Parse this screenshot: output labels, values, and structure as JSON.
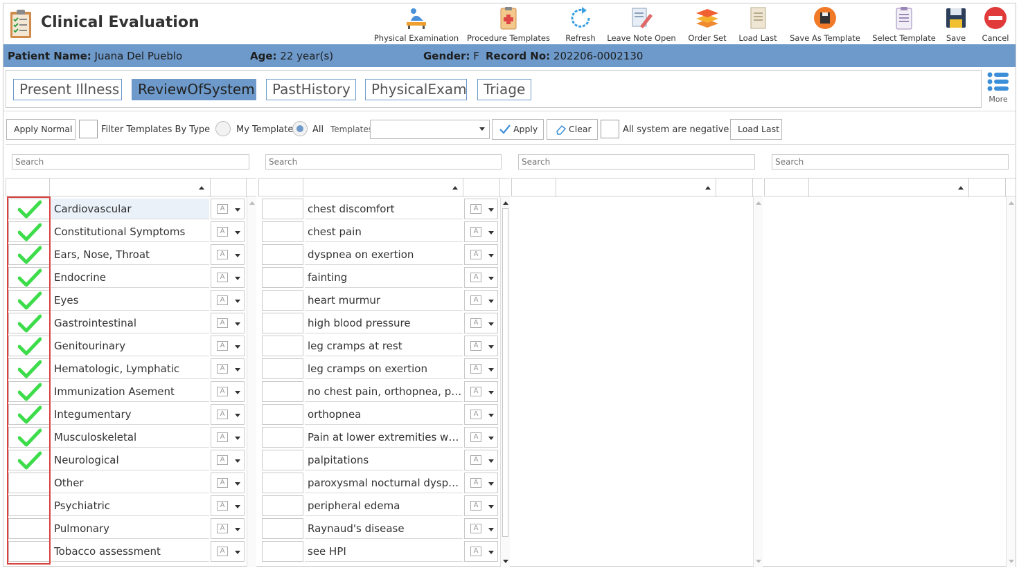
{
  "app": {
    "title": "Clinical Evaluation"
  },
  "toolbar": [
    {
      "label": "Physical Examination",
      "icon": "physical-exam-icon"
    },
    {
      "label": "Procedure Templates",
      "icon": "clipboard-icon"
    },
    {
      "label": "Refresh",
      "icon": "refresh-icon"
    },
    {
      "label": "Leave Note Open",
      "icon": "note-pen-icon"
    },
    {
      "label": "Order Set",
      "icon": "layers-icon"
    },
    {
      "label": "Load Last",
      "icon": "document-icon"
    },
    {
      "label": "Save As Template",
      "icon": "save-circle-icon"
    },
    {
      "label": "Select Template",
      "icon": "template-list-icon"
    },
    {
      "label": "Save",
      "icon": "floppy-icon"
    },
    {
      "label": "Cancel",
      "icon": "cancel-icon"
    }
  ],
  "patient": {
    "name_label": "Patient Name:",
    "name": "Juana Del Pueblo",
    "age_label": "Age:",
    "age": "22 year(s)",
    "gender_label": "Gender:",
    "gender": "F",
    "record_label": "Record No:",
    "record": "202206-0002130"
  },
  "tabs": [
    {
      "label": "Present Illness",
      "active": false
    },
    {
      "label": "ReviewOfSystem",
      "active": true
    },
    {
      "label": "PastHistory",
      "active": false
    },
    {
      "label": "PhysicalExam",
      "active": false
    },
    {
      "label": "Triage",
      "active": false
    }
  ],
  "more_label": "More",
  "filters": {
    "apply_normal": "Apply Normal",
    "filter_by_type": "Filter Templates By Type",
    "my_templates": "My Templates",
    "all": "All",
    "templates_label": "Templates:",
    "templates_value": "",
    "apply": "Apply",
    "clear": "Clear",
    "all_negative": "All system are negative",
    "load_last": "Load Last"
  },
  "search_placeholder": "Search",
  "systems": [
    {
      "label": "Cardiovascular",
      "checked": true
    },
    {
      "label": "Constitutional Symptoms",
      "checked": true
    },
    {
      "label": "Ears, Nose, Throat",
      "checked": true
    },
    {
      "label": "Endocrine",
      "checked": true
    },
    {
      "label": "Eyes",
      "checked": true
    },
    {
      "label": "Gastrointestinal",
      "checked": true
    },
    {
      "label": "Genitourinary",
      "checked": true
    },
    {
      "label": "Hematologic, Lymphatic",
      "checked": true
    },
    {
      "label": "Immunization Asement",
      "checked": true
    },
    {
      "label": "Integumentary",
      "checked": true
    },
    {
      "label": "Musculoskeletal",
      "checked": true
    },
    {
      "label": "Neurological",
      "checked": true
    },
    {
      "label": "Other",
      "checked": false
    },
    {
      "label": "Psychiatric",
      "checked": false
    },
    {
      "label": "Pulmonary",
      "checked": false
    },
    {
      "label": "Tobacco assessment",
      "checked": false
    }
  ],
  "symptoms": [
    "chest discomfort",
    "chest pain",
    "dyspnea on exertion",
    "fainting",
    "heart murmur",
    "high blood pressure",
    "leg cramps at rest",
    "leg cramps on exertion",
    "no chest pain, orthopnea, par...",
    "orthopnea",
    "Pain at lower extremities whil...",
    "palpitations",
    "paroxysmal nocturnal dyspnea",
    "peripheral edema",
    "Raynaud's disease",
    "see HPI"
  ],
  "colors": {
    "banner": "#6d9acb",
    "accent": "#6d9acb",
    "check": "#3ddc4a",
    "highlight": "#d9413d"
  }
}
